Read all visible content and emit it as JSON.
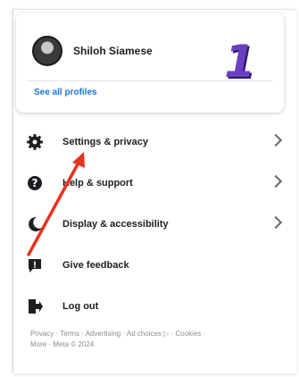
{
  "profile": {
    "name": "Shiloh Siamese",
    "see_all_label": "See all profiles"
  },
  "annotation": {
    "number": "1"
  },
  "menu": {
    "items": [
      {
        "label": "Settings & privacy",
        "icon": "gear-icon",
        "has_chevron": true
      },
      {
        "label": "Help & support",
        "icon": "question-icon",
        "has_chevron": true
      },
      {
        "label": "Display & accessibility",
        "icon": "moon-icon",
        "has_chevron": true
      },
      {
        "label": "Give feedback",
        "icon": "feedback-icon",
        "has_chevron": false
      },
      {
        "label": "Log out",
        "icon": "logout-icon",
        "has_chevron": false
      }
    ]
  },
  "footer": {
    "line1": "Privacy · Terms · Advertising · Ad choices ▷ · Cookies ·",
    "line2": "More · Meta © 2024"
  },
  "colors": {
    "link": "#1b74e4",
    "annotation_arrow": "#e8321c",
    "annotation_number": "#6a3fc0"
  }
}
